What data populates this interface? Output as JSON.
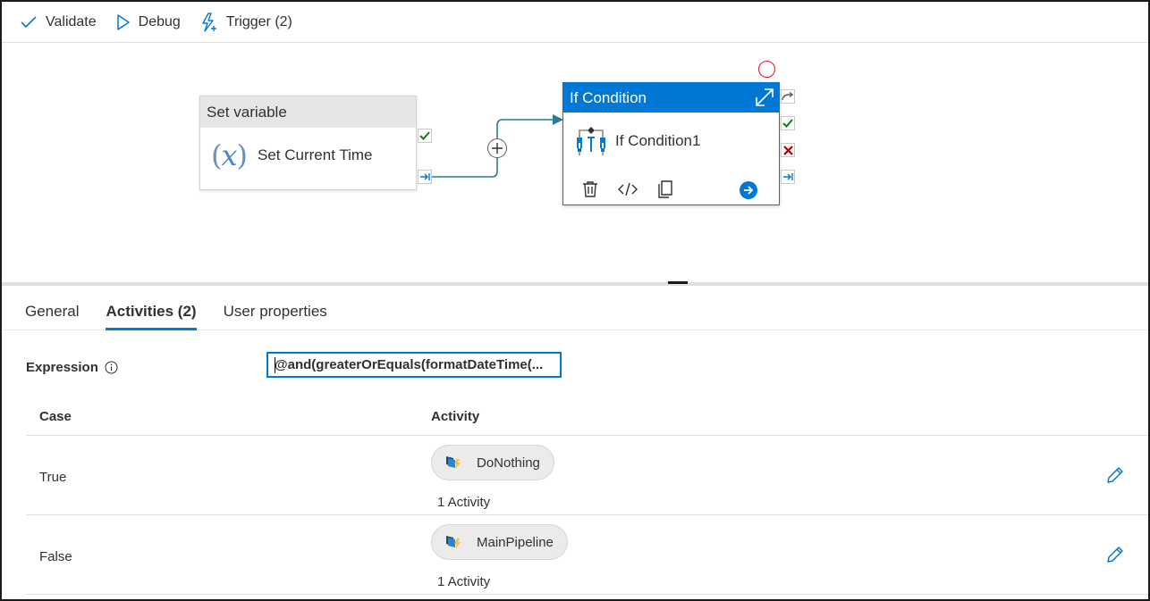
{
  "toolbar": {
    "validate_label": "Validate",
    "debug_label": "Debug",
    "trigger_label": "Trigger (2)"
  },
  "canvas": {
    "set_variable": {
      "header": "Set variable",
      "name": "Set Current Time"
    },
    "if_condition": {
      "header": "If Condition",
      "name": "If Condition1"
    }
  },
  "tabs": [
    {
      "label": "General"
    },
    {
      "label": "Activities (2)"
    },
    {
      "label": "User properties"
    }
  ],
  "expression": {
    "label": "Expression",
    "value": "@and(greaterOrEquals(formatDateTime(..."
  },
  "table": {
    "headers": {
      "case": "Case",
      "activity": "Activity"
    },
    "rows": [
      {
        "case": "True",
        "activity": "DoNothing",
        "count": "1 Activity"
      },
      {
        "case": "False",
        "activity": "MainPipeline",
        "count": "1 Activity"
      }
    ]
  },
  "colors": {
    "accent": "#0078d4",
    "success": "#107c10",
    "error": "#a80000",
    "marker": "#e81123"
  },
  "icons": [
    "checkmark-icon",
    "play-icon",
    "lightning-icon",
    "fx-variable-icon",
    "if-condition-icon",
    "expand-icon",
    "delete-icon",
    "code-icon",
    "copy-icon",
    "arrow-circle-icon",
    "plus-circle-icon",
    "info-icon",
    "pipeline-icon",
    "edit-pencil-icon"
  ]
}
